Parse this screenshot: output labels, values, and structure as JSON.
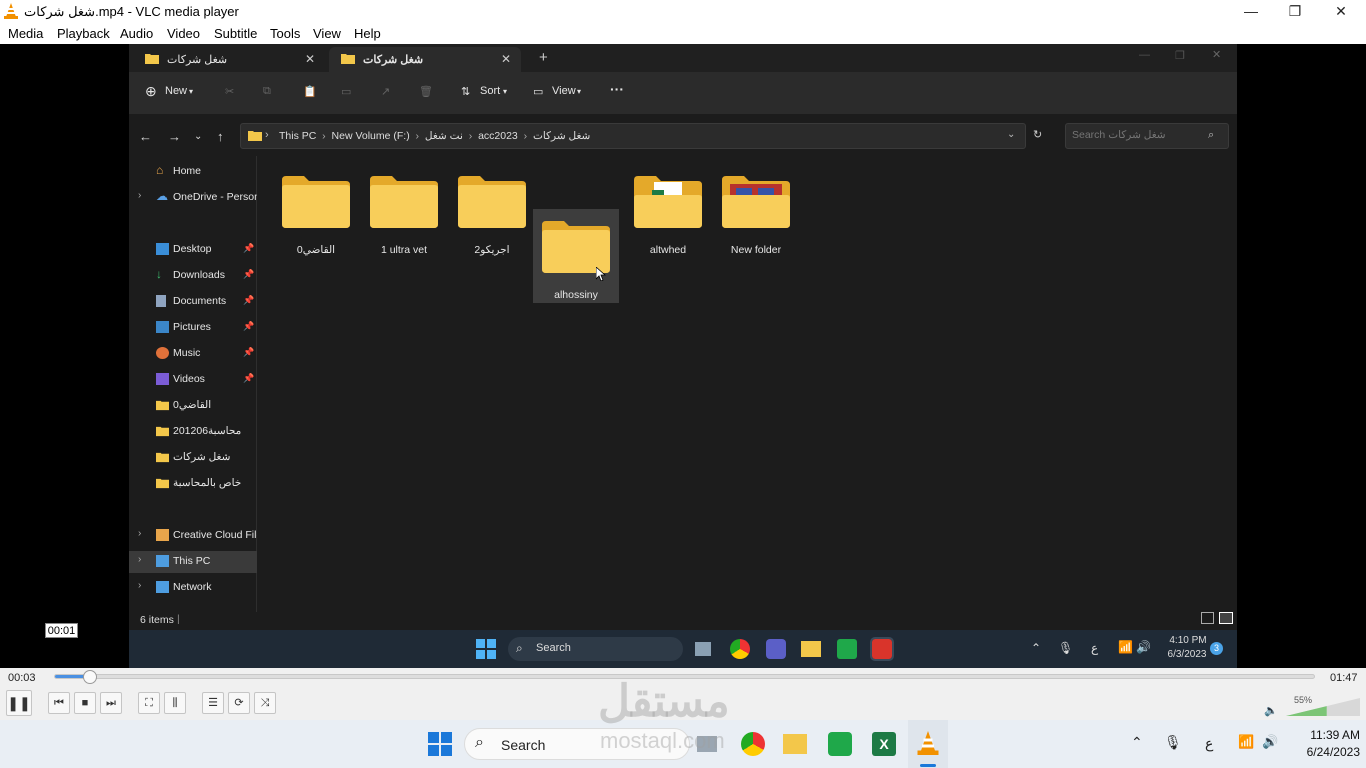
{
  "window": {
    "title": "شغل شركات.mp4 - VLC media player"
  },
  "menu": [
    "Media",
    "Playback",
    "Audio",
    "Video",
    "Subtitle",
    "Tools",
    "View",
    "Help"
  ],
  "explorer": {
    "tabs": [
      {
        "label": "شغل شركات",
        "active": false
      },
      {
        "label": "شغل شركات",
        "active": true
      }
    ],
    "new_tab": "+",
    "toolbar": {
      "new": "New",
      "sort": "Sort",
      "view": "View",
      "more": "···"
    },
    "breadcrumb": [
      "This PC",
      "New Volume (F:)",
      "نت شغل",
      "acc2023",
      "شغل شركات"
    ],
    "search_placeholder": "Search شغل شركات",
    "nav": {
      "home": "Home",
      "onedrive": "OneDrive - Persona",
      "desktop": "Desktop",
      "downloads": "Downloads",
      "documents": "Documents",
      "pictures": "Pictures",
      "music": "Music",
      "videos": "Videos",
      "f1": "0القاضي",
      "f2": "201206محاسبة",
      "f3": "شغل شركات",
      "f4": "خاص بالمحاسبة",
      "creative": "Creative Cloud Files",
      "thispc": "This PC",
      "network": "Network"
    },
    "folders": [
      {
        "name": "0القاضي",
        "selected": false,
        "variant": "plain"
      },
      {
        "name": "1 ultra vet",
        "selected": false,
        "variant": "plain"
      },
      {
        "name": "2اجريكو",
        "selected": false,
        "variant": "plain"
      },
      {
        "name": "alhossiny",
        "selected": true,
        "variant": "plain"
      },
      {
        "name": "altwhed",
        "selected": false,
        "variant": "excel"
      },
      {
        "name": "New folder",
        "selected": false,
        "variant": "media"
      }
    ],
    "status": "6 items",
    "inner_taskbar": {
      "search": "Search",
      "time": "4:10 PM",
      "date": "6/3/2023",
      "lang": "ع",
      "badge": "3"
    }
  },
  "player": {
    "elapsed": "00:03",
    "total": "01:47",
    "tooltip": "00:01",
    "progress_fraction": 0.028,
    "volume_label": "55%",
    "volume_fraction": 0.55
  },
  "taskbar": {
    "search": "Search",
    "time": "11:39 AM",
    "date": "6/24/2023",
    "lang": "ع"
  },
  "watermark": {
    "arabic": "مستقل",
    "latin": "mostaql.com"
  }
}
